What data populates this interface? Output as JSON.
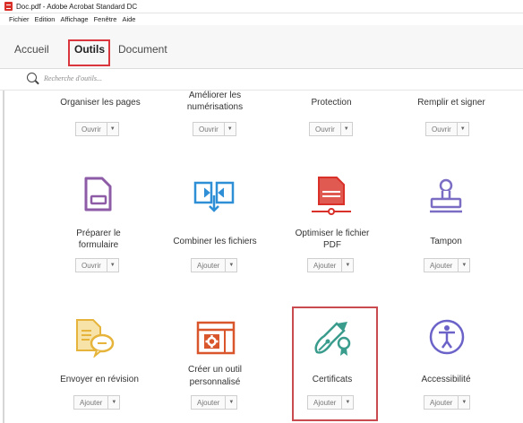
{
  "window": {
    "title": "Doc.pdf - Adobe Acrobat Standard DC"
  },
  "menu": [
    "Fichier",
    "Edition",
    "Affichage",
    "Fenêtre",
    "Aide"
  ],
  "tabs": {
    "home": "Accueil",
    "tools": "Outils",
    "document": "Document"
  },
  "search": {
    "placeholder": "Recherche d'outils..."
  },
  "tools": {
    "organize": {
      "label": "Organiser les pages",
      "button": "Ouvrir"
    },
    "enhance": {
      "label_line1": "Améliorer les",
      "label_line2": "numérisations",
      "button": "Ouvrir"
    },
    "protect": {
      "label": "Protection",
      "button": "Ouvrir"
    },
    "fill_sign": {
      "label": "Remplir et signer",
      "button": "Ouvrir"
    },
    "prepare_form": {
      "label_line1": "Préparer le",
      "label_line2": "formulaire",
      "button": "Ouvrir"
    },
    "combine": {
      "label": "Combiner les fichiers",
      "button": "Ajouter"
    },
    "optimize": {
      "label_line1": "Optimiser le fichier",
      "label_line2": "PDF",
      "button": "Ajouter"
    },
    "stamp": {
      "label": "Tampon",
      "button": "Ajouter"
    },
    "review": {
      "label": "Envoyer en révision",
      "button": "Ajouter"
    },
    "custom_tool": {
      "label_line1": "Créer un outil",
      "label_line2": "personnalisé",
      "button": "Ajouter"
    },
    "certificates": {
      "label": "Certificats",
      "button": "Ajouter"
    },
    "accessibility": {
      "label": "Accessibilité",
      "button": "Ajouter"
    }
  },
  "colors": {
    "highlight": "#d9363e",
    "form": "#8e5ba7",
    "combine": "#2f8fd6",
    "optimize": "#d9302a",
    "stamp": "#7b6cc4",
    "review": "#e6b43a",
    "custom": "#d9552b",
    "cert": "#3a9c8d",
    "access": "#6c63c9"
  }
}
